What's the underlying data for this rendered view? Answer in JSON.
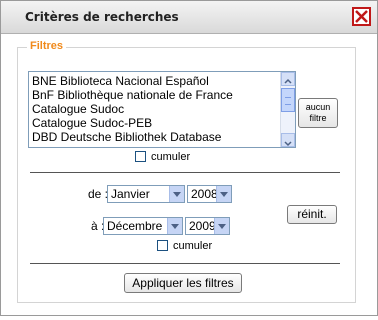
{
  "dialog": {
    "title": "Critères de recherches",
    "close_icon": "close-x-icon"
  },
  "filters": {
    "legend": "Filtres",
    "databases": [
      "BNE Biblioteca Nacional Español",
      "BnF Bibliothèque nationale de France",
      "Catalogue Sudoc",
      "Catalogue Sudoc-PEB",
      "DBD Deutsche Bibliothek Database"
    ],
    "none_filter_line1": "aucun",
    "none_filter_line2": "filtre",
    "cumulate_label": "cumuler"
  },
  "date_range": {
    "from_label": "de :",
    "from_month": "Janvier",
    "from_year": "2008",
    "to_label": "à :",
    "to_month": "Décembre",
    "to_year": "2009",
    "reset_label": "réinit.",
    "cumulate_label": "cumuler"
  },
  "apply_label": "Appliquer les filtres",
  "colors": {
    "legend": "#f08a1c",
    "close": "#c01818"
  }
}
